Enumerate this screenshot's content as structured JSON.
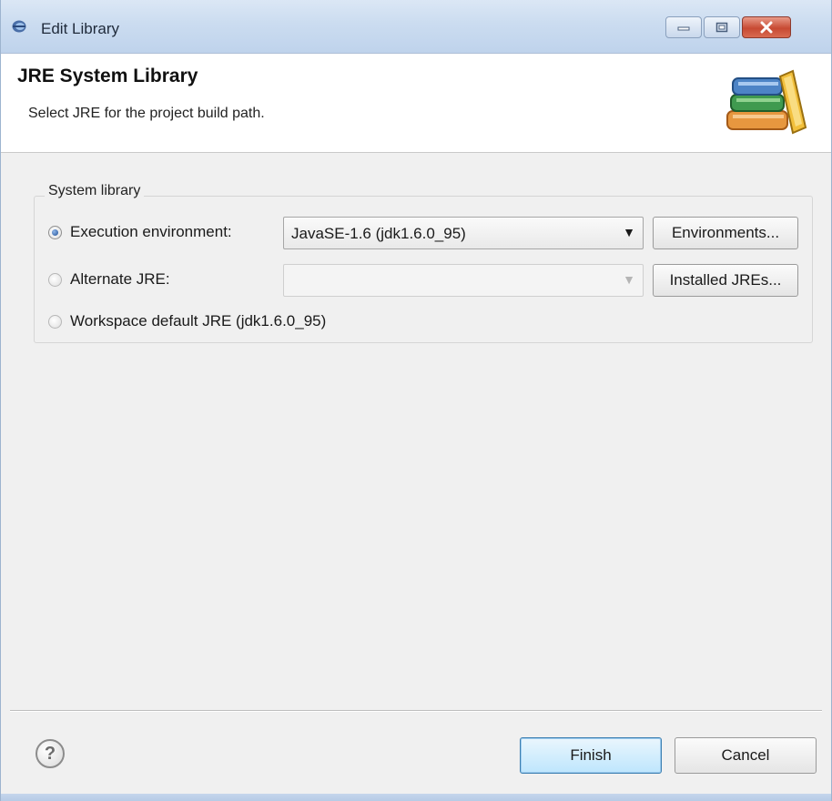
{
  "window": {
    "title": "Edit Library",
    "controls": {
      "minimize_icon": "minimize-icon",
      "maximize_icon": "maximize-icon",
      "close_icon": "close-icon",
      "close_color": "#c74a33"
    }
  },
  "banner": {
    "title": "JRE System Library",
    "subtitle": "Select JRE for the project build path.",
    "logo_icon": "books-library-icon"
  },
  "system_library": {
    "label": "System library",
    "options": [
      {
        "label": "Execution environment:",
        "selected": true,
        "combo_value": "JavaSE-1.6 (jdk1.6.0_95)",
        "button_label": "Environments..."
      },
      {
        "label": "Alternate JRE:",
        "selected": false,
        "combo_value": "",
        "button_label": "Installed JREs..."
      },
      {
        "label": "Workspace default JRE (jdk1.6.0_95)",
        "selected": false
      }
    ]
  },
  "footer": {
    "help_icon": "help-icon",
    "finish_label": "Finish",
    "cancel_label": "Cancel",
    "accent_color": "#3c7fb1"
  }
}
